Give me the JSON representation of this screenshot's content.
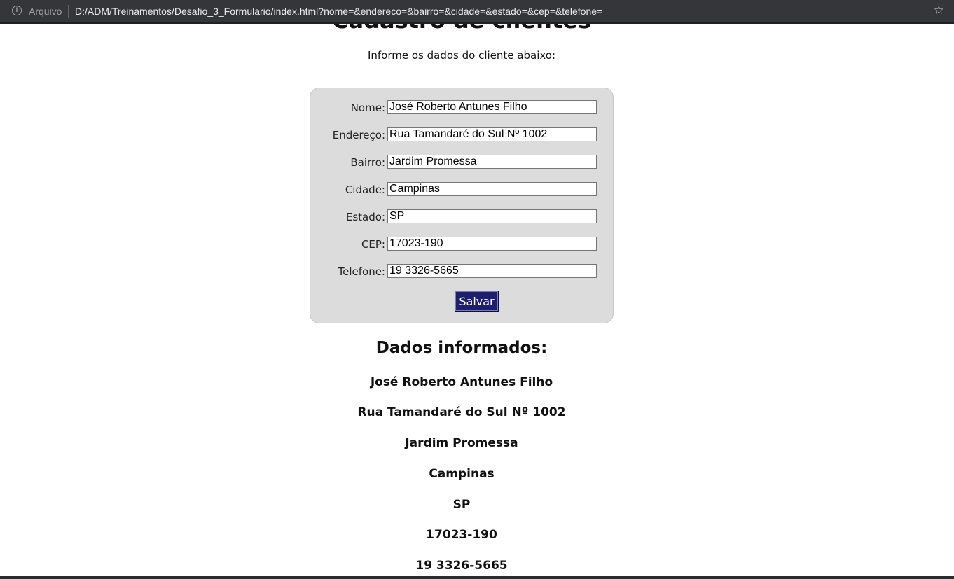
{
  "browser": {
    "security_label": "Arquivo",
    "url": "D:/ADM/Treinamentos/Desafio_3_Formulario/index.html?nome=&endereco=&bairro=&cidade=&estado=&cep=&telefone="
  },
  "page": {
    "title": "Cadastro de clientes",
    "subtitle": "Informe os dados do cliente abaixo:"
  },
  "form": {
    "fields": [
      {
        "label": "Nome:",
        "value": "José Roberto Antunes Filho"
      },
      {
        "label": "Endereço:",
        "value": "Rua Tamandaré do Sul Nº 1002"
      },
      {
        "label": "Bairro:",
        "value": "Jardim Promessa"
      },
      {
        "label": "Cidade:",
        "value": "Campinas"
      },
      {
        "label": "Estado:",
        "value": "SP"
      },
      {
        "label": "CEP:",
        "value": "17023-190"
      },
      {
        "label": "Telefone:",
        "value": "19 3326-5665"
      }
    ],
    "save_label": "Salvar"
  },
  "results": {
    "heading": "Dados informados:",
    "lines": [
      "José Roberto Antunes Filho",
      "Rua Tamandaré do Sul Nº 1002",
      "Jardim Promessa",
      "Campinas",
      "SP",
      "17023-190",
      "19 3326-5665"
    ]
  }
}
